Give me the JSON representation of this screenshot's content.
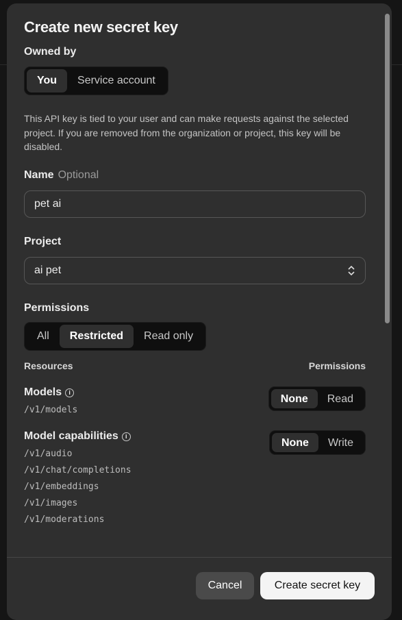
{
  "dialog": {
    "title": "Create new secret key",
    "owned_by": {
      "label": "Owned by",
      "options": [
        "You",
        "Service account"
      ],
      "selected": "You"
    },
    "description": "This API key is tied to your user and can make requests against the selected project. If you are removed from the organization or project, this key will be disabled.",
    "name": {
      "label": "Name",
      "hint": "Optional",
      "value": "pet ai"
    },
    "project": {
      "label": "Project",
      "value": "ai pet"
    },
    "permissions": {
      "label": "Permissions",
      "options": [
        "All",
        "Restricted",
        "Read only"
      ],
      "selected": "Restricted",
      "resources_header": "Resources",
      "permissions_header": "Permissions",
      "resources": [
        {
          "name": "Models",
          "endpoints": [
            "/v1/models"
          ],
          "options": [
            "None",
            "Read"
          ],
          "selected": "None"
        },
        {
          "name": "Model capabilities",
          "endpoints": [
            "/v1/audio",
            "/v1/chat/completions",
            "/v1/embeddings",
            "/v1/images",
            "/v1/moderations"
          ],
          "options": [
            "None",
            "Write"
          ],
          "selected": "None"
        }
      ]
    },
    "cancel": "Cancel",
    "create": "Create secret key"
  }
}
